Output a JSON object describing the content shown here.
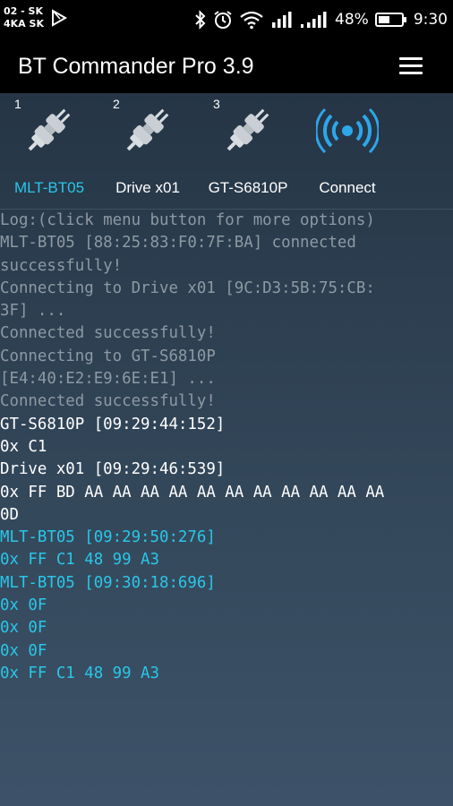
{
  "status_bar": {
    "carrier_line1": "02 - SK",
    "carrier_line2": "4KA SK",
    "battery": "48%",
    "time": "9:30"
  },
  "app": {
    "title": "BT Commander Pro 3.9"
  },
  "devices": [
    {
      "number": "1",
      "label": "MLT-BT05",
      "selected": true
    },
    {
      "number": "2",
      "label": "Drive x01",
      "selected": false
    },
    {
      "number": "3",
      "label": "GT-S6810P",
      "selected": false
    },
    {
      "number": "",
      "label": "Connect",
      "selected": false
    }
  ],
  "log": [
    {
      "text": "Log:(click menu button for more options)",
      "type": "system"
    },
    {
      "text": "MLT-BT05 [88:25:83:F0:7F:BA] connected",
      "type": "system"
    },
    {
      "text": "successfully!",
      "type": "system"
    },
    {
      "text": "Connecting to Drive x01 [9C:D3:5B:75:CB:",
      "type": "system"
    },
    {
      "text": "3F] ...",
      "type": "system"
    },
    {
      "text": "Connected successfully!",
      "type": "system"
    },
    {
      "text": "Connecting to GT-S6810P",
      "type": "system"
    },
    {
      "text": "[E4:40:E2:E9:6E:E1] ...",
      "type": "system"
    },
    {
      "text": "Connected successfully!",
      "type": "system"
    },
    {
      "text": "GT-S6810P [09:29:44:152]",
      "type": "received"
    },
    {
      "text": "0x C1",
      "type": "received"
    },
    {
      "text": "Drive x01 [09:29:46:539]",
      "type": "received"
    },
    {
      "text": "0x FF BD AA AA AA AA AA AA AA AA AA AA AA",
      "type": "received"
    },
    {
      "text": "0D",
      "type": "received"
    },
    {
      "text": "MLT-BT05 [09:29:50:276]",
      "type": "sent"
    },
    {
      "text": "0x FF C1 48 99 A3",
      "type": "sent"
    },
    {
      "text": "MLT-BT05 [09:30:18:696]",
      "type": "sent"
    },
    {
      "text": "0x 0F",
      "type": "sent"
    },
    {
      "text": "0x 0F",
      "type": "sent"
    },
    {
      "text": "0x 0F",
      "type": "sent"
    },
    {
      "text": "0x FF C1 48 99 A3",
      "type": "sent"
    }
  ],
  "colors": {
    "system": "#8e99a3",
    "received": "#ffffff",
    "sent": "#29c7e8",
    "selected_label": "#29c7e8",
    "connect_icon": "#2ea6ea"
  },
  "icons": {
    "status": [
      "notification-sim-icon",
      "play-store-icon",
      "bluetooth-icon",
      "alarm-icon",
      "wifi-icon",
      "signal-icon",
      "signal-icon-2",
      "battery-icon"
    ],
    "devices": [
      "plug-icon",
      "plug-icon",
      "plug-icon",
      "bluetooth-signal-icon"
    ],
    "menu": "hamburger-menu-icon"
  }
}
